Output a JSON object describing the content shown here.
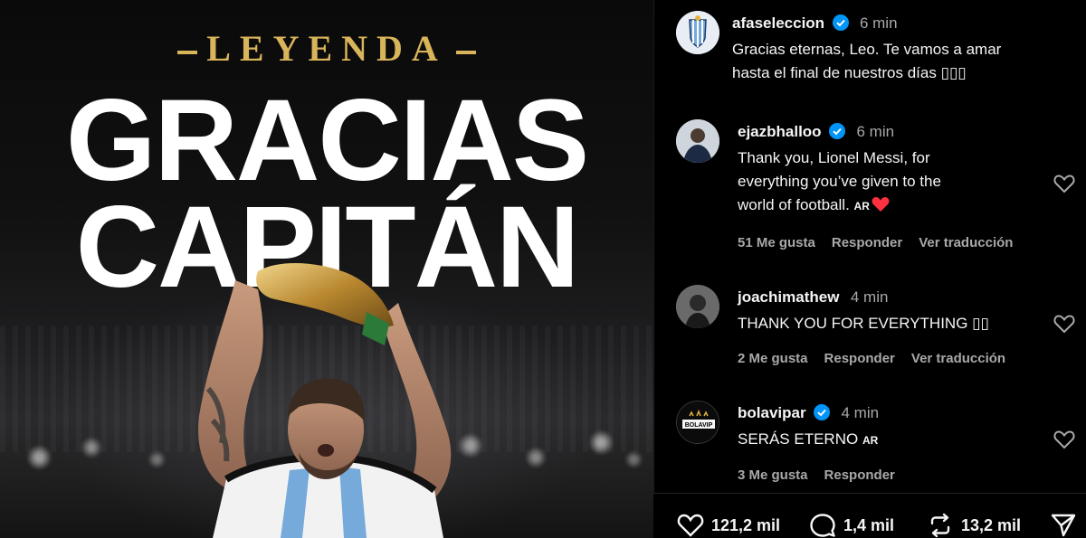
{
  "post_image": {
    "legend_word": "LEYENDA",
    "headline_line1": "GRACIAS",
    "headline_line2": "CAPITÁN"
  },
  "comments": [
    {
      "username": "afaseleccion",
      "verified": true,
      "time": "6 min",
      "text_line1": "Gracias eternas, Leo. Te vamos a amar",
      "text_line2": "hasta el final de nuestros días ▯▯▯"
    },
    {
      "username": "ejazbhalloo",
      "verified": true,
      "time": "6 min",
      "text_line1": "Thank you, Lionel Messi, for",
      "text_line2": "everything you’ve given to the",
      "text_line3": "world of football.",
      "flag": "AR",
      "likes": "51 Me gusta",
      "reply": "Responder",
      "translate": "Ver traducción"
    },
    {
      "username": "joachimathew",
      "verified": false,
      "time": "4 min",
      "text_line1": "THANK YOU FOR EVERYTHING ▯▯",
      "likes": "2 Me gusta",
      "reply": "Responder",
      "translate": "Ver traducción"
    },
    {
      "username": "bolavipar",
      "verified": true,
      "time": "4 min",
      "text_line1": "SERÁS ETERNO",
      "flag": "AR",
      "likes": "3 Me gusta",
      "reply": "Responder",
      "avatar_text": "BOLAVIP"
    }
  ],
  "actions": {
    "likes": "121,2 mil",
    "comments": "1,4 mil",
    "reposts": "13,2 mil"
  },
  "colors": {
    "verified": "#0095f6",
    "heart_red": "#ff3040",
    "legend_gold": "#d8b45a",
    "muted_text": "#a8a8a8"
  }
}
